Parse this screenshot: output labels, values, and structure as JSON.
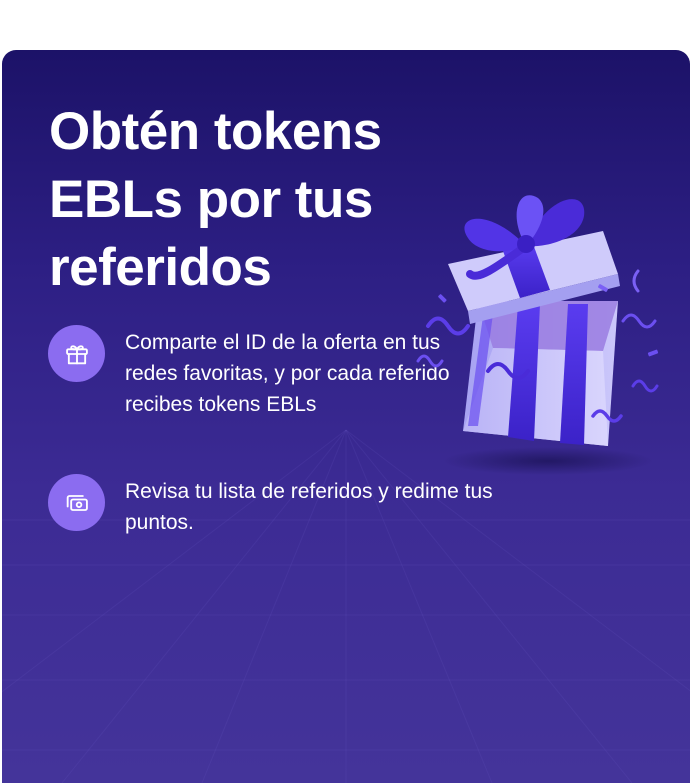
{
  "promo": {
    "title_lines": [
      "Obtén tokens",
      "EBLs por tus",
      "referidos"
    ],
    "features": [
      {
        "icon": "gift-icon",
        "text": "Comparte el ID de la oferta en tus redes favoritas, y por cada referido recibes tokens EBLs"
      },
      {
        "icon": "money-cards-icon",
        "text": "Revisa tu lista de referidos y redime tus puntos."
      }
    ],
    "illustration": "open-gift-box-icon"
  },
  "colors": {
    "background_top": "#1c1268",
    "background_bottom": "#44349a",
    "icon_circle": "#8b6cf0",
    "text": "#ffffff"
  }
}
